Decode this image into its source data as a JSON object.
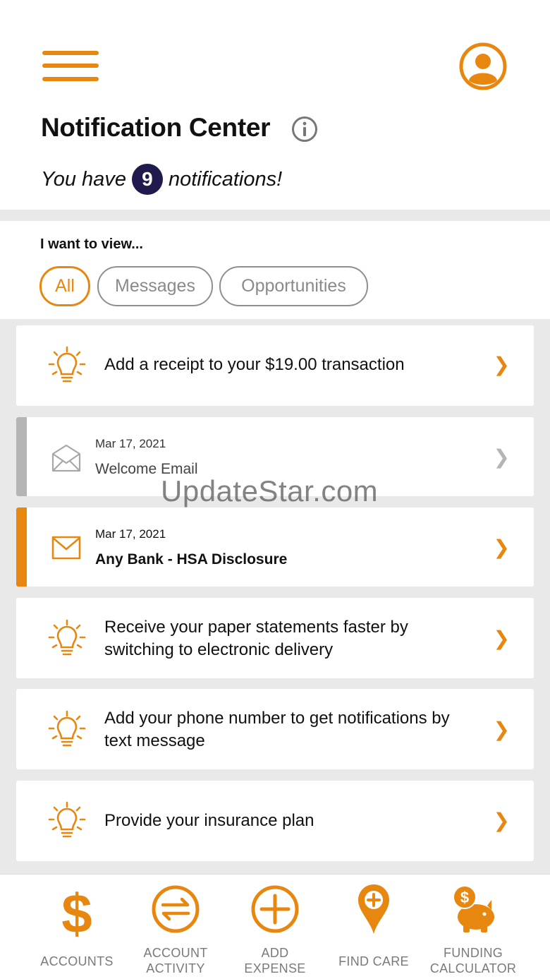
{
  "header": {
    "title": "Notification Center",
    "count_prefix": "You have",
    "count": "9",
    "count_suffix": "notifications!"
  },
  "filters": {
    "label": "I want to view...",
    "options": [
      "All",
      "Messages",
      "Opportunities"
    ],
    "selected": "All"
  },
  "notifications": [
    {
      "type": "opportunity",
      "icon": "lightbulb-icon",
      "text": "Add a receipt to your $19.00 transaction"
    },
    {
      "type": "message",
      "status": "read",
      "icon": "envelope-open-icon",
      "date": "Mar 17, 2021",
      "subject": "Welcome Email"
    },
    {
      "type": "message",
      "status": "unread",
      "icon": "envelope-icon",
      "date": "Mar 17, 2021",
      "subject": "Any Bank - HSA Disclosure"
    },
    {
      "type": "opportunity",
      "icon": "lightbulb-icon",
      "text_line1": "Receive your paper statements faster by",
      "text_line2": "switching to electronic delivery"
    },
    {
      "type": "opportunity",
      "icon": "lightbulb-icon",
      "text_line1": "Add your phone number to get notifications by",
      "text_line2": "text message"
    },
    {
      "type": "opportunity",
      "icon": "lightbulb-icon",
      "text": "Provide your insurance plan"
    }
  ],
  "watermark": "UpdateStar.com",
  "bottom_nav": [
    {
      "label_line1": "ACCOUNTS",
      "label_line2": "",
      "icon": "dollar-icon"
    },
    {
      "label_line1": "ACCOUNT",
      "label_line2": "ACTIVITY",
      "icon": "transfer-arrows-icon"
    },
    {
      "label_line1": "ADD",
      "label_line2": "EXPENSE",
      "icon": "plus-circle-icon"
    },
    {
      "label_line1": "FIND CARE",
      "label_line2": "",
      "icon": "map-pin-plus-icon"
    },
    {
      "label_line1": "FUNDING",
      "label_line2": "CALCULATOR",
      "icon": "piggy-bank-icon"
    }
  ],
  "colors": {
    "accent": "#e8870f",
    "badge": "#1f1b4d",
    "read_bar": "#b5b5b5",
    "chip_border": "#8f8f8f"
  }
}
